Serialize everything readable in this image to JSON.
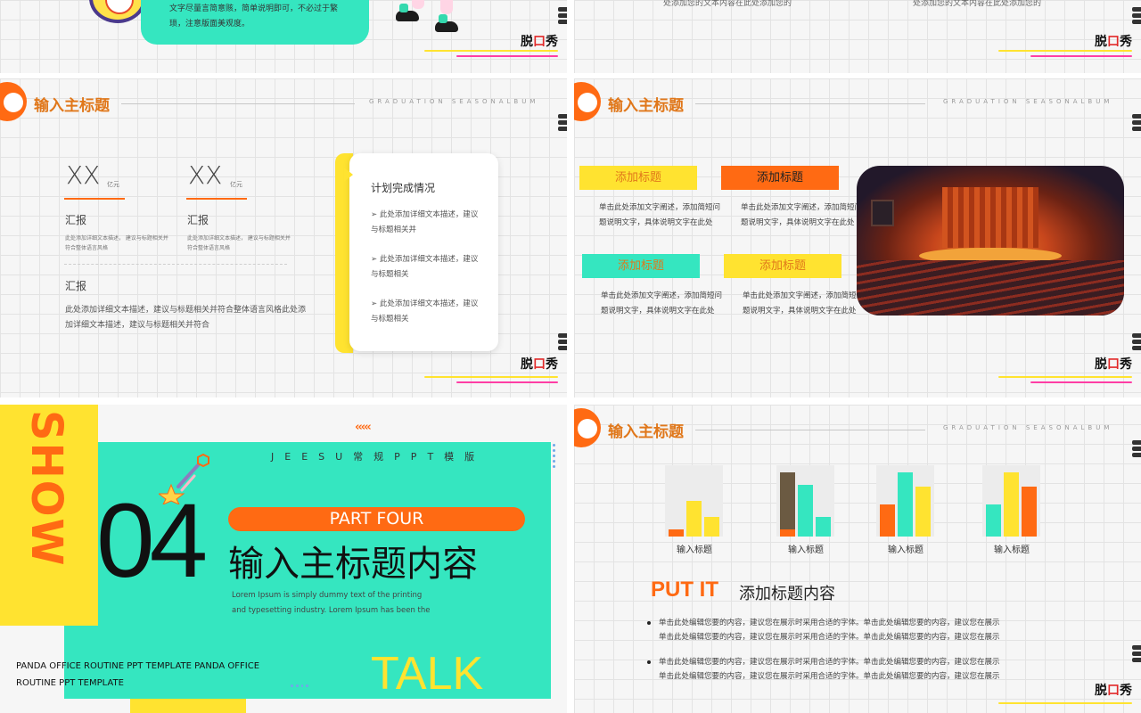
{
  "header": {
    "title": "输入主标题",
    "subtitle": "GRADUATION SEASONALBUM"
  },
  "logo": {
    "text_a": "脱",
    "text_b": "口",
    "text_c": "秀"
  },
  "top_left": {
    "card_text": "文字尽量言简意赅，简单说明即可，不必过于繁琐，注意版面美观度。"
  },
  "top_right": {
    "text_left": "处添加您的文本内容在此处添加您的",
    "text_right": "处添加您的文本内容在此处添加您的"
  },
  "mid_left": {
    "stat1_value": "XX",
    "stat1_unit": "亿元",
    "stat1_label": "汇报",
    "stat1_desc": "此处添加详细文本描述， 建议与标题相关并符合整体语言风格",
    "stat2_value": "XX",
    "stat2_unit": "亿元",
    "stat2_label": "汇报",
    "stat2_desc": "此处添加详细文本描述， 建议与标题相关并符合整体语言风格",
    "report_label": "汇报",
    "report_text": "此处添加详细文本描述，建议与标题相关并符合整体语言风格此处添加详细文本描述，建议与标题相关并符合",
    "plan_title": "计划完成情况",
    "plan_items": [
      "➢ 此处添加详细文本描述，建议与标题相关并",
      "➢ 此处添加详细文本描述，建议与标题相关",
      "➢ 此处添加详细文本描述，建议与标题相关"
    ]
  },
  "mid_right": {
    "pills": [
      "添加标题",
      "添加标题",
      "添加标题",
      "添加标题"
    ],
    "texts": [
      "单击此处添加文字阐述，添加简短问题说明文字，具体说明文字在此处",
      "单击此处添加文字阐述，添加简短问题说明文字，具体说明文字在此处",
      "单击此处添加文字阐述，添加简短问题说明文字，具体说明文字在此处",
      "单击此处添加文字阐述，添加简短问题说明文字，具体说明文字在此处"
    ]
  },
  "bottom_left": {
    "show": "SHOW",
    "brand": "JEESU常规PPT模版",
    "number": "04",
    "part": "PART FOUR",
    "title": "输入主标题内容",
    "lorem": "Lorem Ipsum is simply dummy text of the printing and typesetting industry. Lorem Ipsum has been the",
    "talk": "TALK",
    "panda": "PANDA OFFICE ROUTINE PPT TEMPLATE PANDA OFFICE ROUTINE PPT TEMPLATE"
  },
  "bottom_right": {
    "bar_labels": [
      "输入标题",
      "输入标题",
      "输入标题",
      "输入标题"
    ],
    "putit": "PUT IT",
    "putit_sub": "添加标题内容",
    "bullet1_line1": "单击此处编辑您要的内容，建议您在展示时采用合适的字体。单击此处编辑您要的内容，建议您在展示",
    "bullet1_line2": "单击此处编辑您要的内容，建议您在展示时采用合适的字体。单击此处编辑您要的内容，建议您在展示",
    "bullet2_line1": "单击此处编辑您要的内容，建议您在展示时采用合适的字体。单击此处编辑您要的内容，建议您在展示",
    "bullet2_line2": "单击此处编辑您要的内容，建议您在展示时采用合适的字体。单击此处编辑您要的内容，建议您在展示"
  },
  "chart_data": {
    "type": "bar",
    "categories": [
      "输入标题",
      "输入标题",
      "输入标题",
      "输入标题"
    ],
    "series": [
      {
        "values": [
          10,
          90,
          45,
          45
        ]
      },
      {
        "values": [
          50,
          72,
          90,
          90
        ]
      },
      {
        "values": [
          28,
          28,
          70,
          70
        ]
      }
    ],
    "ylim": [
      0,
      100
    ]
  },
  "colors": {
    "orange": "#ff6a13",
    "teal": "#35e6c0",
    "yellow": "#ffe330",
    "title_orange": "#e0771a"
  }
}
